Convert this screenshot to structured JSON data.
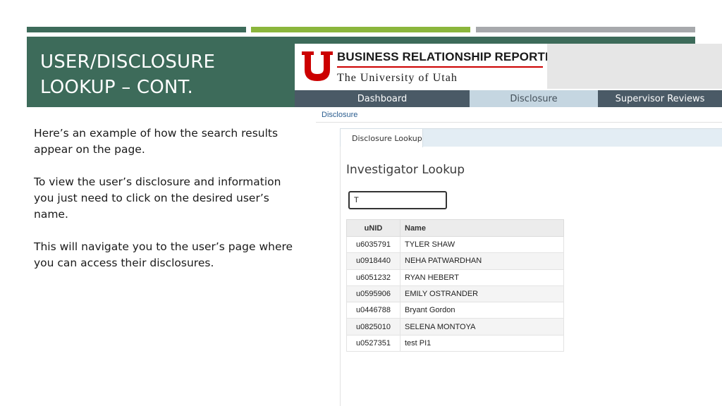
{
  "slide": {
    "title": "USER/DISCLOSURE LOOKUP – CONT.",
    "paragraphs": [
      "Here’s an example of how the search results appear on the page.",
      "To view the user’s disclosure and information you just need to click on the desired user’s name.",
      "This will navigate you to the user’s page where you can access their disclosures."
    ],
    "colors": {
      "accent_green_dark": "#3d6b5a",
      "accent_green_light": "#8bb63c",
      "accent_grey": "#a7a9ac"
    }
  },
  "app": {
    "brand": {
      "logo_icon": "university-of-utah-u-logo",
      "line1": "BUSINESS RELATIONSHIP REPORTING",
      "line2": "The University of Utah",
      "logo_color": "#cc0000"
    },
    "nav": [
      {
        "label": "Dashboard",
        "active": false
      },
      {
        "label": "Disclosure",
        "active": true
      },
      {
        "label": "Supervisor Reviews",
        "active": false
      }
    ],
    "breadcrumb": "Disclosure",
    "panel_tab": "Disclosure Lookup",
    "lookup_title": "Investigator Lookup",
    "search": {
      "value": "T"
    },
    "table": {
      "columns": [
        "uNID",
        "Name"
      ],
      "rows": [
        {
          "unid": "u6035791",
          "name": "TYLER SHAW"
        },
        {
          "unid": "u0918440",
          "name": "NEHA PATWARDHAN"
        },
        {
          "unid": "u6051232",
          "name": "RYAN HEBERT"
        },
        {
          "unid": "u0595906",
          "name": "EMILY OSTRANDER"
        },
        {
          "unid": "u0446788",
          "name": "Bryant Gordon"
        },
        {
          "unid": "u0825010",
          "name": "SELENA MONTOYA"
        },
        {
          "unid": "u0527351",
          "name": "test PI1"
        }
      ]
    }
  }
}
